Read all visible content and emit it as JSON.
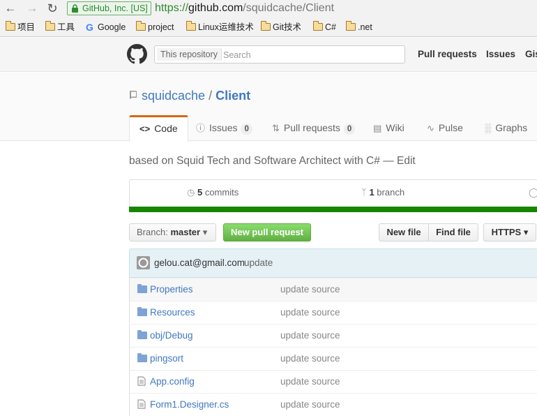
{
  "browser": {
    "security_label": "GitHub, Inc. [US]",
    "url_protocol": "https://",
    "url_host": "github.com",
    "url_path": "/squidcache/Client",
    "bookmarks": [
      "项目",
      "工具",
      "Google",
      "project",
      "Linux运维技术",
      "Git技术",
      "C#",
      ".net"
    ]
  },
  "header": {
    "search_scope": "This repository",
    "search_placeholder": "Search",
    "nav": [
      "Pull requests",
      "Issues",
      "Gist"
    ]
  },
  "repo": {
    "owner": "squidcache",
    "separator": "/",
    "name": "Client",
    "tabs": [
      {
        "label": "Code",
        "icon": "code-icon"
      },
      {
        "label": "Issues",
        "count": "0",
        "icon": "issue-icon"
      },
      {
        "label": "Pull requests",
        "count": "0",
        "icon": "pull-request-icon"
      },
      {
        "label": "Wiki",
        "icon": "book-icon"
      },
      {
        "label": "Pulse",
        "icon": "pulse-icon"
      },
      {
        "label": "Graphs",
        "icon": "graph-icon"
      }
    ],
    "description": "based on Squid Tech and Software Architect with C#",
    "description_sep": "—",
    "edit_label": "Edit",
    "commits_count": "5",
    "commits_label": "commits",
    "branch_count": "1",
    "branch_label": "branch"
  },
  "toolbar": {
    "branch_prefix": "Branch:",
    "branch_name": "master",
    "new_pr": "New pull request",
    "new_file": "New file",
    "find_file": "Find file",
    "clone_protocol": "HTTPS"
  },
  "latest_commit": {
    "author": "gelou.cat@gmail.com",
    "message": "update"
  },
  "files": [
    {
      "name": "Properties",
      "type": "dir",
      "message": "update source"
    },
    {
      "name": "Resources",
      "type": "dir",
      "message": "update source"
    },
    {
      "name": "obj/Debug",
      "type": "dir",
      "message": "update source"
    },
    {
      "name": "pingsort",
      "type": "dir",
      "message": "update source"
    },
    {
      "name": "App.config",
      "type": "file",
      "message": "update source"
    },
    {
      "name": "Form1.Designer.cs",
      "type": "file",
      "message": "update source"
    }
  ],
  "colors": {
    "link": "#4078c0",
    "tab_accent": "#d26911",
    "lang_bar": "#178600",
    "new_pr_green": "#60b044",
    "secure_green": "#2f8a2f"
  }
}
